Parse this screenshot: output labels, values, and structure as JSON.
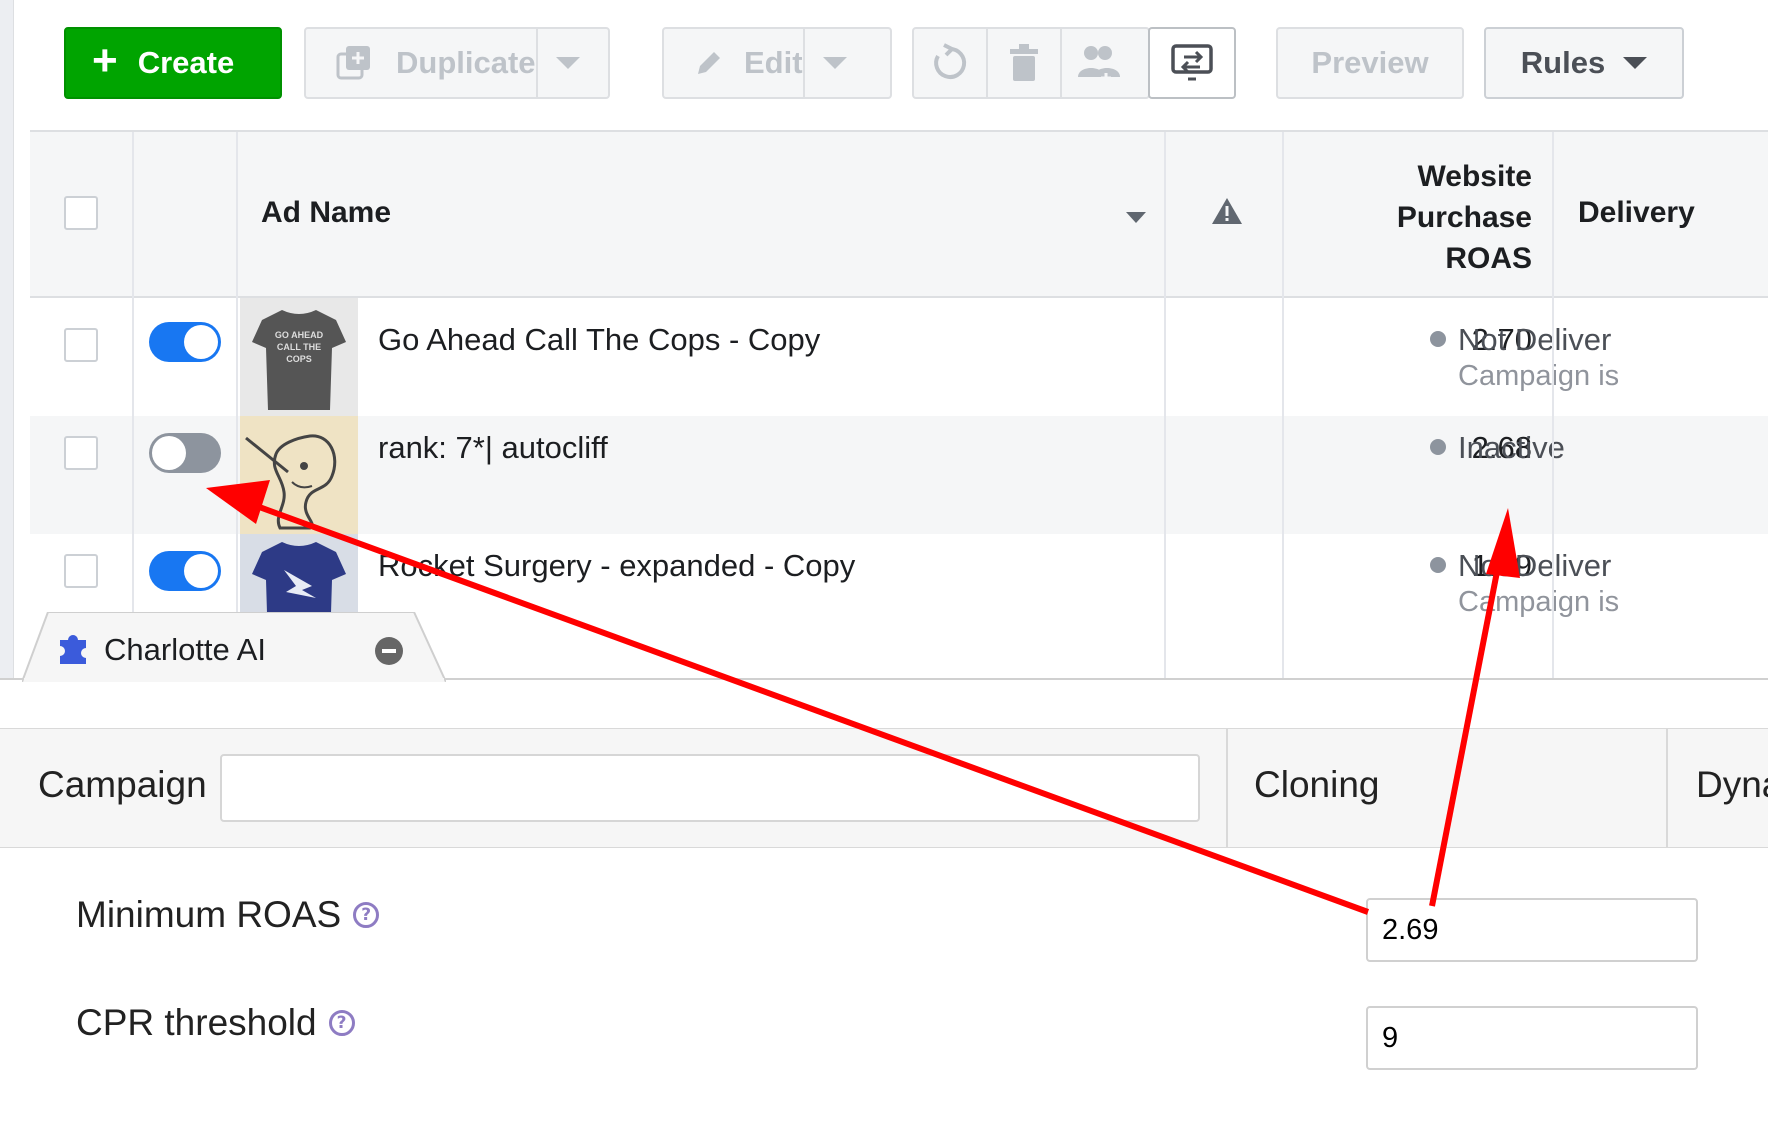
{
  "toolbar": {
    "create_label": "Create",
    "duplicate_label": "Duplicate",
    "edit_label": "Edit",
    "preview_label": "Preview",
    "rules_label": "Rules"
  },
  "table": {
    "columns": {
      "ad_name": "Ad Name",
      "roas_line1": "Website",
      "roas_line2": "Purchase",
      "roas_line3": "ROAS",
      "delivery": "Delivery"
    },
    "rows": [
      {
        "toggle": "on",
        "name": "Go Ahead Call The Cops - Copy",
        "thumb_text": "GO AHEAD CALL THE COPS",
        "roas": "2.70",
        "delivery": "Not Deliver",
        "delivery_sub": "Campaign is"
      },
      {
        "toggle": "off",
        "name": "rank: 7*| autocliff",
        "roas": "2.68",
        "delivery": "Inactive",
        "delivery_sub": ""
      },
      {
        "toggle": "on",
        "name": "Rocket Surgery - expanded - Copy",
        "roas": "1.99",
        "delivery": "Not Deliver",
        "delivery_sub": "Campaign is"
      }
    ]
  },
  "panel": {
    "tab_title": "Charlotte AI",
    "campaign_label": "Campaign",
    "campaign_value": "",
    "cloning_label": "Cloning",
    "dyn_label": "Dyna",
    "min_roas_label": "Minimum ROAS",
    "min_roas_value": "2.69",
    "cpr_label": "CPR threshold",
    "cpr_value": "9",
    "help_glyph": "?"
  },
  "colors": {
    "create_green": "#00a400",
    "toggle_on": "#1877f2",
    "toggle_off": "#8d949e",
    "annotation_red": "#ff0000",
    "help_purple": "#8e7cc3"
  }
}
